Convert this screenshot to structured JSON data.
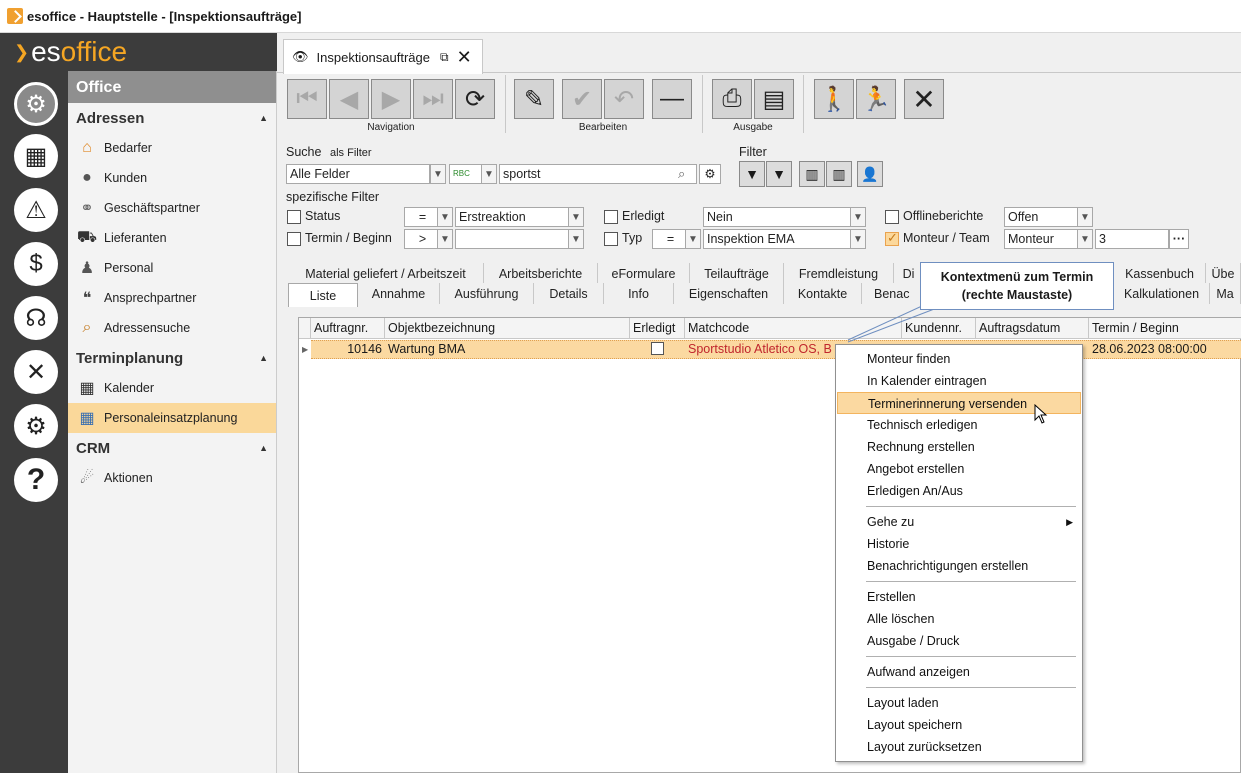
{
  "window": {
    "title": "esoffice - Hauptstelle - [Inspektionsaufträge]"
  },
  "brand": {
    "prefix": "es",
    "suffix": "office"
  },
  "iconbar": [
    "office-icon",
    "planner-icon",
    "alarm-icon",
    "money-icon",
    "support-icon",
    "tools-icon",
    "settings-icon",
    "help-icon"
  ],
  "nav": {
    "header": "Office",
    "sections": [
      {
        "title": "Adressen",
        "items": [
          "Bedarfer",
          "Kunden",
          "Geschäftspartner",
          "Lieferanten",
          "Personal",
          "Ansprechpartner",
          "Adressensuche"
        ]
      },
      {
        "title": "Terminplanung",
        "items": [
          "Kalender",
          "Personaleinsatzplanung"
        ]
      },
      {
        "title": "CRM",
        "items": [
          "Aktionen"
        ]
      }
    ],
    "selected": "Personaleinsatzplanung"
  },
  "doc_tab": {
    "label": "Inspektionsaufträge"
  },
  "toolbar": {
    "groups": [
      {
        "label": "Navigation"
      },
      {
        "label": "Bearbeiten"
      },
      {
        "label": "Ausgabe"
      }
    ]
  },
  "search": {
    "label": "Suche",
    "filter_label": "als Filter",
    "field": "Alle Felder",
    "value": "sportst",
    "filter_title": "Filter"
  },
  "spec_filter": {
    "title": "spezifische Filter",
    "status_label": "Status",
    "status_op": "=",
    "status_value": "Erstreaktion",
    "termin_label": "Termin / Beginn",
    "termin_op": ">",
    "termin_value": "",
    "erledigt_label": "Erledigt",
    "erledigt_value": "Nein",
    "typ_label": "Typ",
    "typ_op": "=",
    "typ_value": "Inspektion EMA",
    "offline_label": "Offlineberichte",
    "offline_value": "Offen",
    "monteur_label": "Monteur / Team",
    "monteur_value": "Monteur",
    "monteur_num": "3",
    "more_button": "···"
  },
  "tabs_row1": [
    "Material geliefert / Arbeitszeit",
    "Arbeitsberichte",
    "eFormulare",
    "Teilaufträge",
    "Fremdleistung",
    "Di",
    "Kassenbuch",
    "Übe"
  ],
  "tabs_row2": [
    "Liste",
    "Annahme",
    "Ausführung",
    "Details",
    "Info",
    "Eigenschaften",
    "Kontakte",
    "Benac",
    "Kalkulationen",
    "Ma"
  ],
  "grid": {
    "columns": [
      "Auftragnr.",
      "Objektbezeichnung",
      "Erledigt",
      "Matchcode",
      "Kundennr.",
      "Auftragsdatum",
      "Termin / Beginn"
    ],
    "row": {
      "auftragnr": "10146",
      "objekt": "Wartung BMA",
      "matchcode": "Sportstudio Atletico OS, B",
      "termin": "28.06.2023 08:00:00"
    }
  },
  "callout": {
    "line1": "Kontextmenü zum Termin",
    "line2": "(rechte Maustaste)"
  },
  "context_menu": {
    "items": [
      "Monteur finden",
      "In Kalender eintragen",
      "Terminerinnerung versenden",
      "Technisch erledigen",
      "Rechnung erstellen",
      "Angebot erstellen",
      "Erledigen An/Aus",
      "Gehe zu",
      "Historie",
      "Benachrichtigungen erstellen",
      "Erstellen",
      "Alle löschen",
      "Ausgabe / Druck",
      "Aufwand anzeigen",
      "Layout laden",
      "Layout speichern",
      "Layout zurücksetzen"
    ],
    "highlighted": "Terminerinnerung versenden"
  },
  "colors": {
    "accent": "#f5a623",
    "selection": "#fbd9a1",
    "sidebar": "#3c3c3c",
    "matchcode": "#c0262d"
  }
}
